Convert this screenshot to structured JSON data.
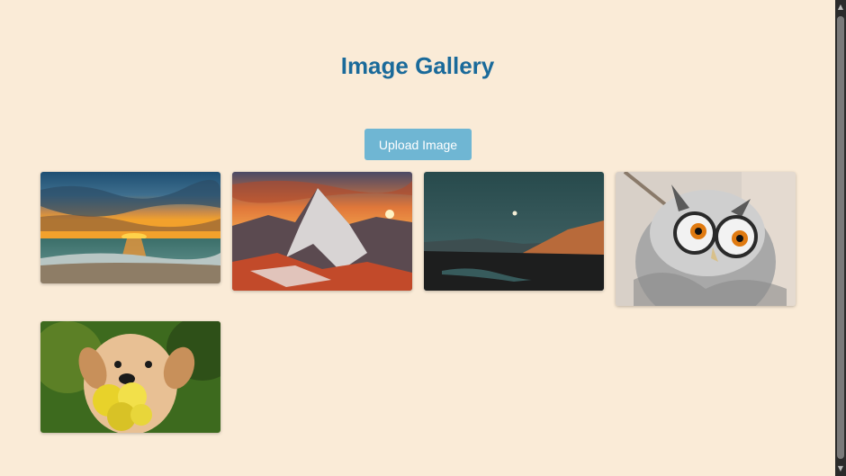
{
  "header": {
    "title": "Image Gallery"
  },
  "toolbar": {
    "upload_label": "Upload Image"
  },
  "gallery": {
    "images": [
      {
        "subject": "sunset over ocean beach"
      },
      {
        "subject": "mountain peak at sunset"
      },
      {
        "subject": "moon over dark valley"
      },
      {
        "subject": "white-faced owl"
      },
      {
        "subject": "puppy holding yellow flower"
      }
    ]
  },
  "scrollbar": {
    "up_icon": "triangle-up",
    "down_icon": "triangle-down"
  },
  "colors": {
    "background": "#faebd7",
    "title": "#1a6a9a",
    "button": "#6fb6d3"
  }
}
